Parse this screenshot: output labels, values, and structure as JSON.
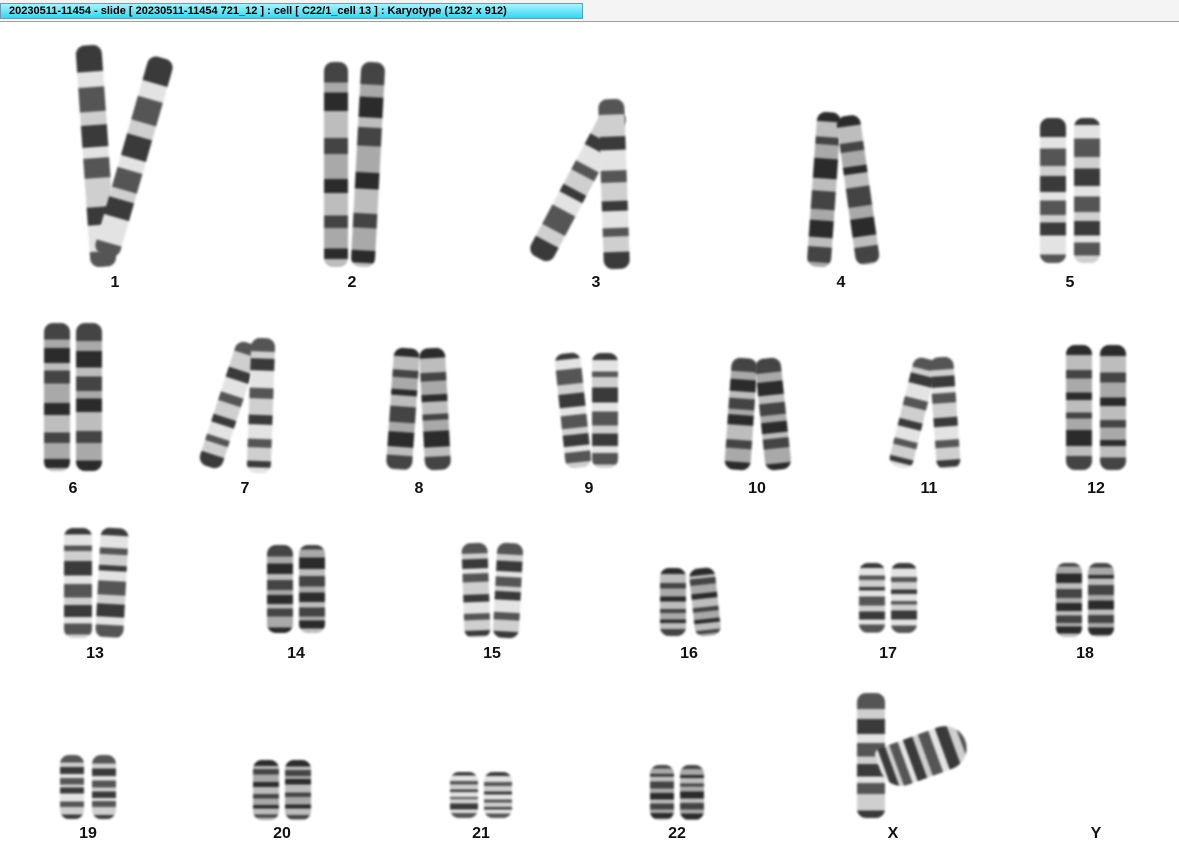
{
  "window": {
    "title": "20230511-11454 - slide [ 20230511-11454 721_12 ] : cell [ C22/1_cell 13 ] : Karyotype  (1232 x 912)"
  },
  "karyotype": {
    "labels": [
      "1",
      "2",
      "3",
      "4",
      "5",
      "6",
      "7",
      "8",
      "9",
      "10",
      "11",
      "12",
      "13",
      "14",
      "15",
      "16",
      "17",
      "18",
      "19",
      "20",
      "21",
      "22",
      "X",
      "Y"
    ]
  }
}
